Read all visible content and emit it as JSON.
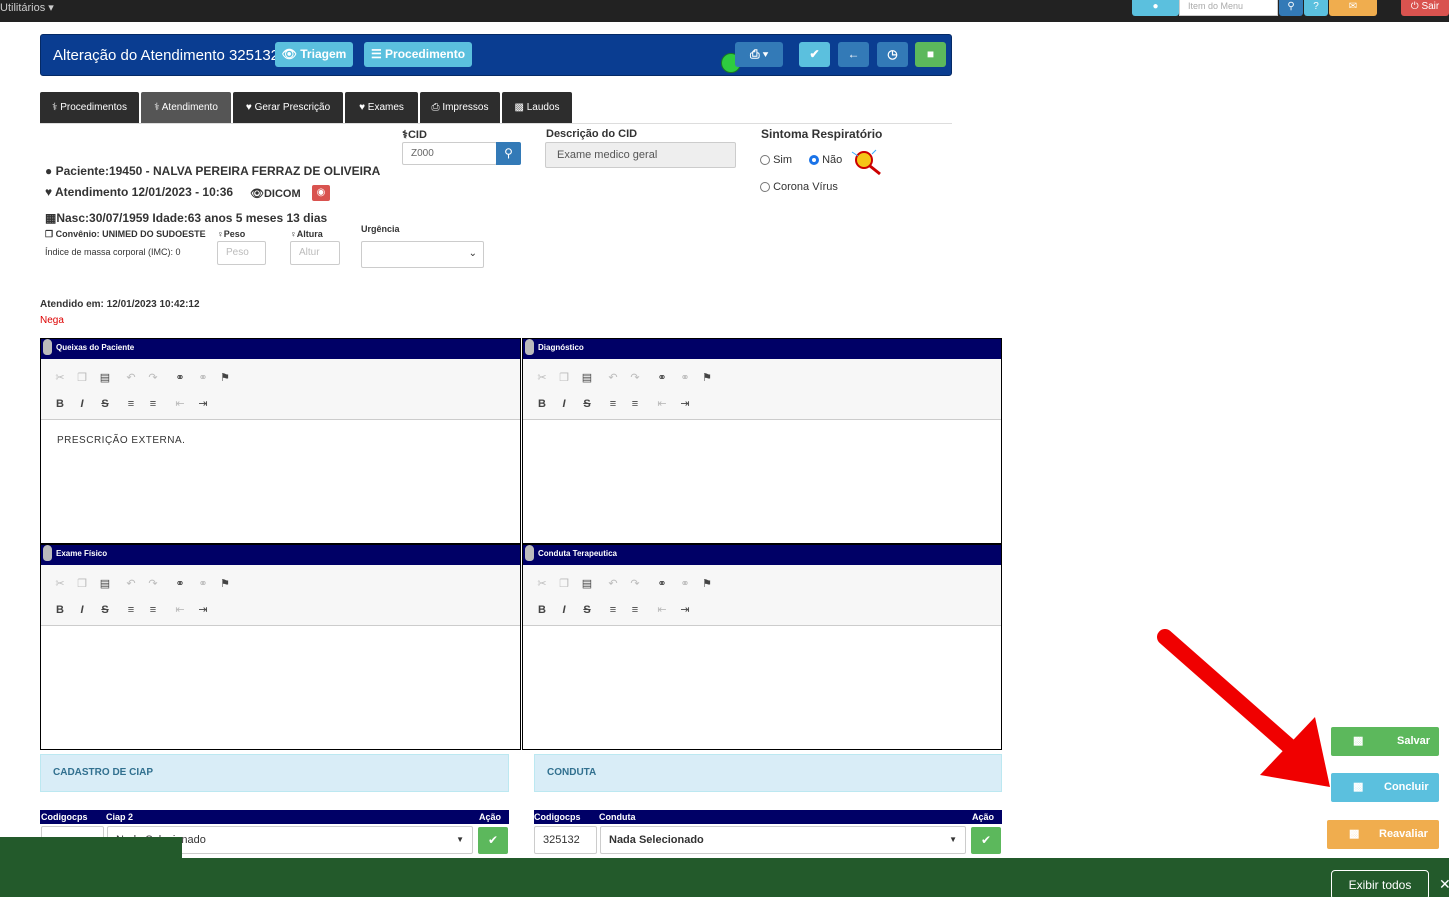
{
  "topbar": {
    "utilitarios": "Utilitários",
    "search_placeholder": "Item do Menu",
    "logout": "Sair"
  },
  "header": {
    "title": "Alteração do Atendimento 325132",
    "triagem": "Triagem",
    "procedimento": "Procedimento"
  },
  "tabs": [
    "Procedimentos",
    "Atendimento",
    "Gerar Prescrição",
    "Exames",
    "Impressos",
    "Laudos"
  ],
  "cid": {
    "label": "CID",
    "value": "Z000",
    "desc_label": "Descrição do CID",
    "desc_value": "Exame medico geral"
  },
  "sintoma": {
    "label": "Sintoma Respiratório",
    "sim": "Sim",
    "nao": "Não",
    "corona": "Corona Vírus"
  },
  "patient": {
    "paciente": "Paciente:19450 - NALVA PEREIRA FERRAZ DE OLIVEIRA",
    "atendimento": "Atendimento 12/01/2023 - 10:36",
    "dicom": "DICOM",
    "nasc": "Nasc:30/07/1959 Idade:63 anos 5 meses 13 dias",
    "convenio": "Convênio: UNIMED DO SUDOESTE",
    "imc": "Índice de massa corporal (IMC): 0",
    "peso_label": "Peso",
    "peso_placeholder": "Peso",
    "altura_label": "Altura",
    "altura_placeholder": "Altur",
    "urgencia_label": "Urgência"
  },
  "atendido": {
    "label": "Atendido em: 12/01/2023 10:42:12",
    "nega": "Nega"
  },
  "panels": {
    "queixas": "Queixas do Paciente",
    "queixas_text": "PRESCRIÇÃO EXTERNA.",
    "diagnostico": "Diagnóstico",
    "exame": "Exame Físico",
    "conduta_ter": "Conduta Terapeutica"
  },
  "ciap": {
    "title": "CADASTRO DE CIAP",
    "col1": "Codigocps",
    "col2": "Ciap 2",
    "col3": "Ação",
    "select": "Nada Selecionado"
  },
  "conduta": {
    "title": "CONDUTA",
    "col1": "Codigocps",
    "col2": "Conduta",
    "col3": "Ação",
    "code": "325132",
    "select": "Nada Selecionado"
  },
  "side": {
    "salvar": "Salvar",
    "concluir": "Concluir",
    "reavaliar": "Reavaliar"
  },
  "downloads": {
    "exibir": "Exibir todos"
  },
  "colors": {
    "header_blue": "#0a3d91",
    "panel_navy": "#000066",
    "arrow_red": "#f00000",
    "download_bar": "#235a2b"
  }
}
